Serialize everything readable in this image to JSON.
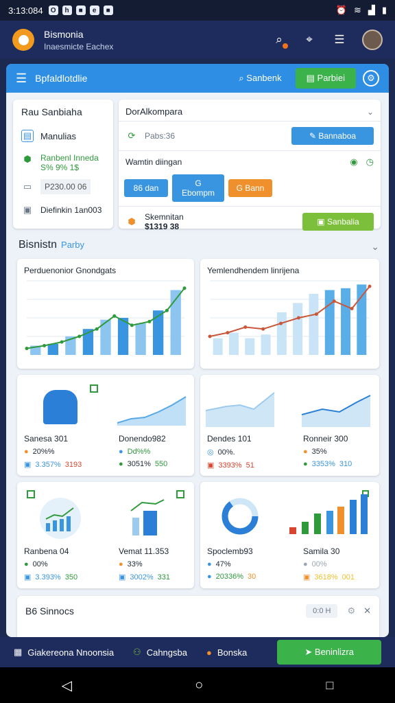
{
  "status": {
    "time": "3:13:084",
    "icons": [
      "O",
      "h",
      "■",
      "e",
      "■"
    ]
  },
  "app": {
    "title": "Bismonia",
    "subtitle": "Inaesmicte Eachex"
  },
  "toolbar": {
    "title": "Bpfaldlotdlie",
    "search": "Sanbenk",
    "primary": "Parbiei"
  },
  "left_card": {
    "title": "Rau Sanbiaha",
    "items": [
      {
        "label": "Manulias"
      },
      {
        "label": "Ranbenl Inneda",
        "sub": "S% 9% 1$"
      },
      {
        "label": "P230.00 06"
      },
      {
        "label": "Diefinkin 1an003"
      }
    ]
  },
  "right_card": {
    "title": "DorAlkompara",
    "row1_label": "Pabs:36",
    "row1_button": "Bannaboa",
    "row2_label": "Wamtin diingan",
    "chips": [
      "86 dan",
      "G Ebompm",
      "G Bann"
    ],
    "row3_label": "Skemnitan",
    "row3_value": "$1319 38",
    "row3_button": "Sanbalia"
  },
  "section": {
    "title": "Bisnistn",
    "tag": "Parby"
  },
  "charts": [
    {
      "title": "Perduenonior Gnondgats",
      "bars": [
        10,
        12,
        20,
        28,
        38,
        40,
        34,
        48,
        70
      ],
      "line": [
        7,
        10,
        14,
        20,
        28,
        42,
        32,
        36,
        48,
        72
      ]
    },
    {
      "title": "Yemlendhendem linrijena",
      "bars": [
        18,
        24,
        18,
        22,
        46,
        56,
        66,
        70,
        72,
        76
      ],
      "line": [
        20,
        24,
        30,
        28,
        34,
        40,
        44,
        58,
        50,
        74
      ]
    }
  ],
  "mini_cards": [
    {
      "left": {
        "name": "Sanesa 301",
        "p1": "20%%",
        "p2": "3.357%",
        "p3": "3193"
      },
      "right": {
        "name": "Donendo982",
        "p1": "Dd%%",
        "p2": "3051%",
        "p3": "550"
      }
    },
    {
      "left": {
        "name": "Dendes 101",
        "p1": "00%.",
        "p2": "3393%",
        "p3": "51"
      },
      "right": {
        "name": "Ronneir 300",
        "p1": "35%",
        "p2": "3353%",
        "p3": "310"
      }
    },
    {
      "left": {
        "name": "Ranbena 04",
        "p1": "00%",
        "p2": "3.393%",
        "p3": "350"
      },
      "right": {
        "name": "Vemat 11.353",
        "p1": "33%",
        "p2": "3002%",
        "p3": "331"
      }
    },
    {
      "left": {
        "name": "Spoclemb93",
        "p1": "47%",
        "p2": "20336%",
        "p3": "30"
      },
      "right": {
        "name": "Samila 30",
        "p1": "00%",
        "p2": "3618%",
        "p3": "001"
      }
    }
  ],
  "bottom_section": {
    "title": "B6 Sinnocs",
    "button": "0:0"
  },
  "bottom_nav": {
    "items": [
      "Giakereona Nnoonsia",
      "Cahngsba",
      "Bonska"
    ],
    "cta": "Beninlizra"
  }
}
